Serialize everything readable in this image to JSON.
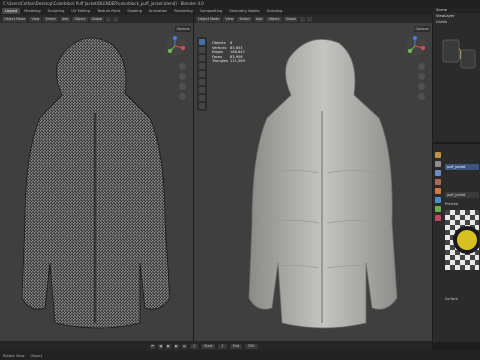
{
  "window": {
    "title": "C:\\Users\\Cotton\\Desktop\\Colorblock Puff Jacket\\BLENDER\\colorblock_puff_jacket.blend] - Blender 4.0"
  },
  "menubar": {
    "tabs": [
      "Layout",
      "Modeling",
      "Sculpting",
      "UV Editing",
      "Texture Paint",
      "Shading",
      "Animation",
      "Rendering",
      "Compositing",
      "Geometry Nodes",
      "Scripting"
    ],
    "active_tab": "Layout"
  },
  "left_viewport": {
    "mode": "Object Mode",
    "menus": [
      "View",
      "Select",
      "Add",
      "Object"
    ],
    "transform": "Global",
    "options_label": "Options"
  },
  "right_viewport": {
    "mode": "Object Mode",
    "menus": [
      "View",
      "Select",
      "Add",
      "Object"
    ],
    "transform": "Global",
    "options_label": "Options",
    "stats": {
      "rows": [
        {
          "label": "Objects",
          "value": "6"
        },
        {
          "label": "Vertices",
          "value": "83,653"
        },
        {
          "label": "Edges",
          "value": "166,847"
        },
        {
          "label": "Faces",
          "value": "83,906"
        },
        {
          "label": "Triangles",
          "value": "111,569"
        }
      ]
    }
  },
  "outliner": {
    "title": "Scene",
    "view_layer": "ViewLayer",
    "display_mode": "Unlink"
  },
  "properties": {
    "selected_object": "puff_jacket",
    "material_name": "puff_jacket",
    "preview_label": "Preview",
    "surface_label": "Surface"
  },
  "timeline": {
    "start_label": "Start",
    "start_value": "1",
    "end_label": "End",
    "end_value": "250",
    "current_frame": "1"
  },
  "statusbar": {
    "items": [
      "Rotate View",
      "Object"
    ]
  },
  "colors": {
    "accent": "#4a6da5",
    "viewport_bg": "#3f3f3f",
    "selected_row": "#3d5680"
  }
}
